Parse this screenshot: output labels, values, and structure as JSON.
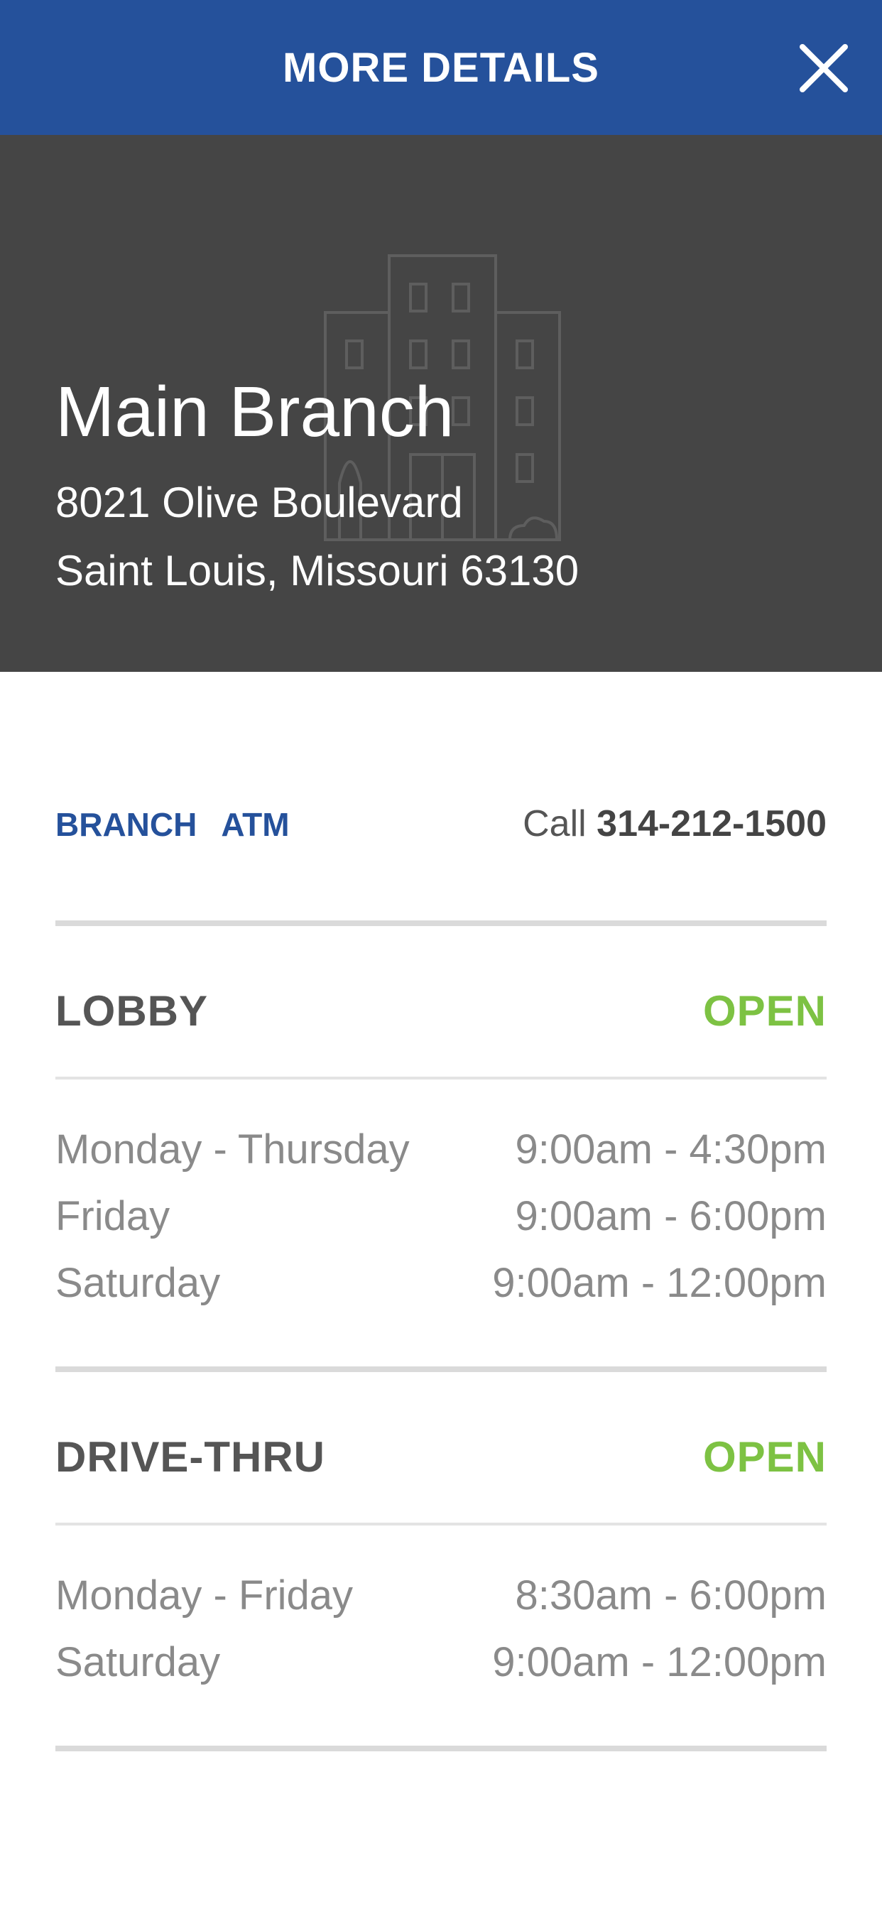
{
  "header": {
    "title": "MORE DETAILS",
    "close_icon": "close-icon"
  },
  "colors": {
    "header_bg": "#25519b",
    "hero_bg": "#454545",
    "accent": "#25519b",
    "open": "#7dc243"
  },
  "branch": {
    "name": "Main Branch",
    "address_line1": "8021 Olive Boulevard",
    "address_line2": "Saint Louis, Missouri 63130",
    "illustration_icon": "building-icon"
  },
  "tabs": [
    {
      "label": "BRANCH"
    },
    {
      "label": "ATM"
    }
  ],
  "contact": {
    "call_label": "Call",
    "phone": "314-212-1500"
  },
  "sections": {
    "lobby": {
      "title": "LOBBY",
      "status": "OPEN",
      "hours": [
        {
          "day": "Monday - Thursday",
          "time": "9:00am - 4:30pm"
        },
        {
          "day": "Friday",
          "time": "9:00am - 6:00pm"
        },
        {
          "day": "Saturday",
          "time": "9:00am - 12:00pm"
        }
      ]
    },
    "drive_thru": {
      "title": "DRIVE-THRU",
      "status": "OPEN",
      "hours": [
        {
          "day": "Monday - Friday",
          "time": "8:30am - 6:00pm"
        },
        {
          "day": "Saturday",
          "time": "9:00am - 12:00pm"
        }
      ]
    }
  }
}
